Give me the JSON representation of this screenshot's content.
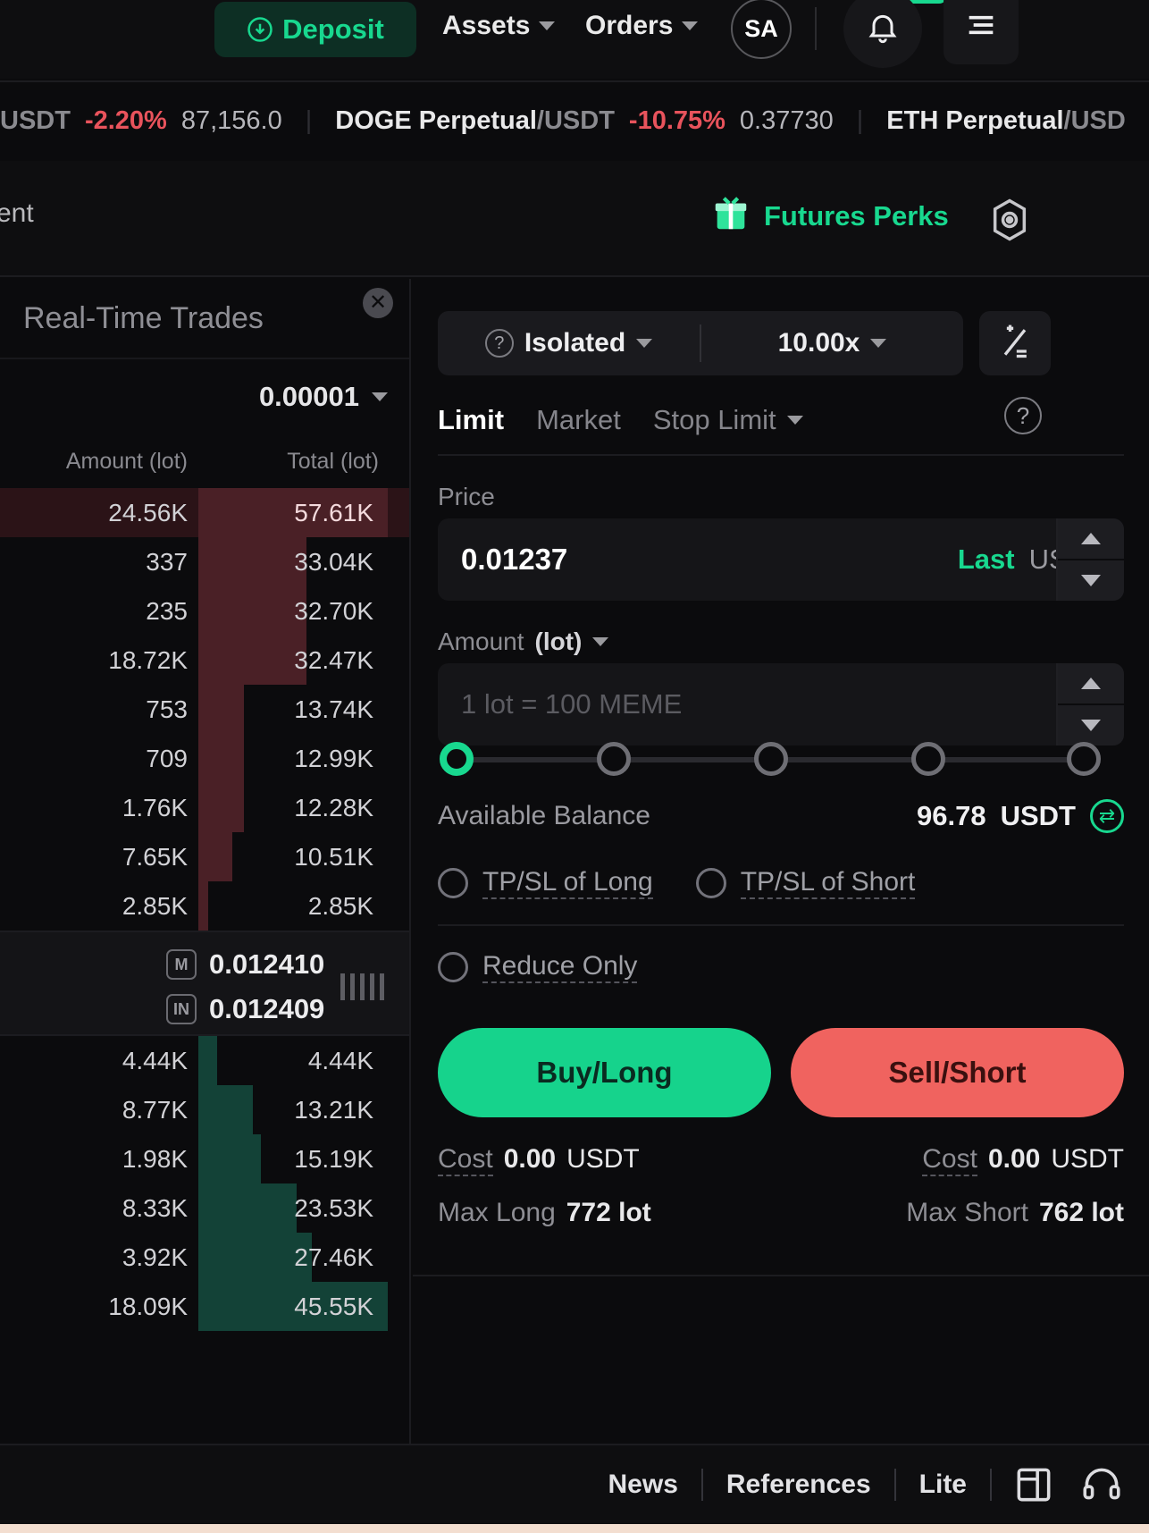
{
  "topnav": {
    "deposit_label": "Deposit",
    "deposit_icon": "deposit-arrow-icon",
    "assets_label": "Assets",
    "orders_label": "Orders",
    "avatar_initials": "SA",
    "bell_icon": "notification-bell-icon",
    "menu_icon": "hamburger-menu-icon"
  },
  "ticker": {
    "item0_quote": "USDT",
    "item0_change": "-2.20%",
    "item0_price": "87,156.0",
    "item1_name": "DOGE Perpetual",
    "item1_quote": "/USDT",
    "item1_change": "-10.75%",
    "item1_price": "0.37730",
    "item2_name": "ETH Perpetual",
    "item2_quote": "/USD"
  },
  "subheader": {
    "breadcrumb_fragment": "ent",
    "perks_label": "Futures Perks",
    "perks_icon": "gift-icon",
    "settings_icon": "gear-icon"
  },
  "orderbook": {
    "title": "Real-Time Trades",
    "close_icon": "close-icon",
    "tick_size": "0.00001",
    "col_amount": "Amount (lot)",
    "col_total": "Total (lot)",
    "asks": [
      {
        "amount": "24.56K",
        "total": "57.61K",
        "depth": 100
      },
      {
        "amount": "337",
        "total": "33.04K",
        "depth": 57
      },
      {
        "amount": "235",
        "total": "32.70K",
        "depth": 57
      },
      {
        "amount": "18.72K",
        "total": "32.47K",
        "depth": 57
      },
      {
        "amount": "753",
        "total": "13.74K",
        "depth": 24
      },
      {
        "amount": "709",
        "total": "12.99K",
        "depth": 24
      },
      {
        "amount": "1.76K",
        "total": "12.28K",
        "depth": 24
      },
      {
        "amount": "7.65K",
        "total": "10.51K",
        "depth": 18
      },
      {
        "amount": "2.85K",
        "total": "2.85K",
        "depth": 5
      }
    ],
    "mid": {
      "mark_badge": "M",
      "mark_price": "0.012410",
      "index_badge": "IN",
      "index_price": "0.012409",
      "bars_icon": "signal-bars-icon"
    },
    "bids": [
      {
        "amount": "4.44K",
        "total": "4.44K",
        "depth": 10
      },
      {
        "amount": "8.77K",
        "total": "13.21K",
        "depth": 29
      },
      {
        "amount": "1.98K",
        "total": "15.19K",
        "depth": 33
      },
      {
        "amount": "8.33K",
        "total": "23.53K",
        "depth": 52
      },
      {
        "amount": "3.92K",
        "total": "27.46K",
        "depth": 60
      },
      {
        "amount": "18.09K",
        "total": "45.55K",
        "depth": 100
      }
    ]
  },
  "orderform": {
    "margin_mode": "Isolated",
    "margin_info_icon": "question-circle-icon",
    "leverage": "10.00x",
    "calculator_icon": "calculator-icon",
    "tabs": [
      {
        "label": "Limit",
        "active": true
      },
      {
        "label": "Market",
        "active": false
      },
      {
        "label": "Stop Limit",
        "active": false
      }
    ],
    "help_icon": "question-circle-icon",
    "price_label": "Price",
    "price_value": "0.01237",
    "price_last_label": "Last",
    "price_unit": "USDT",
    "amount_label": "Amount",
    "amount_unit_label": "(lot)",
    "amount_placeholder": "1 lot = 100 MEME",
    "amount_suffix": "lot",
    "slider_positions": [
      0,
      25,
      50,
      75,
      100
    ],
    "slider_value": 0,
    "balance_label": "Available Balance",
    "balance_value": "96.78",
    "balance_unit": "USDT",
    "balance_swap_icon": "swap-currency-icon",
    "tpsl_long": "TP/SL of Long",
    "tpsl_short": "TP/SL of Short",
    "reduce_only": "Reduce Only",
    "buy_label": "Buy/Long",
    "sell_label": "Sell/Short",
    "cost_long_label": "Cost",
    "cost_long_value": "0.00",
    "cost_long_unit": "USDT",
    "cost_short_label": "Cost",
    "cost_short_value": "0.00",
    "cost_short_unit": "USDT",
    "max_long_label": "Max Long",
    "max_long_value": "772 lot",
    "max_short_label": "Max Short",
    "max_short_value": "762 lot"
  },
  "footer": {
    "news": "News",
    "references": "References",
    "lite": "Lite",
    "layout_icon": "layout-panel-icon",
    "support_icon": "headset-support-icon"
  },
  "colors": {
    "accent_green": "#18d88f",
    "down_red": "#e8535c",
    "sell_red": "#f0635f",
    "buy_green": "#16d38c"
  }
}
